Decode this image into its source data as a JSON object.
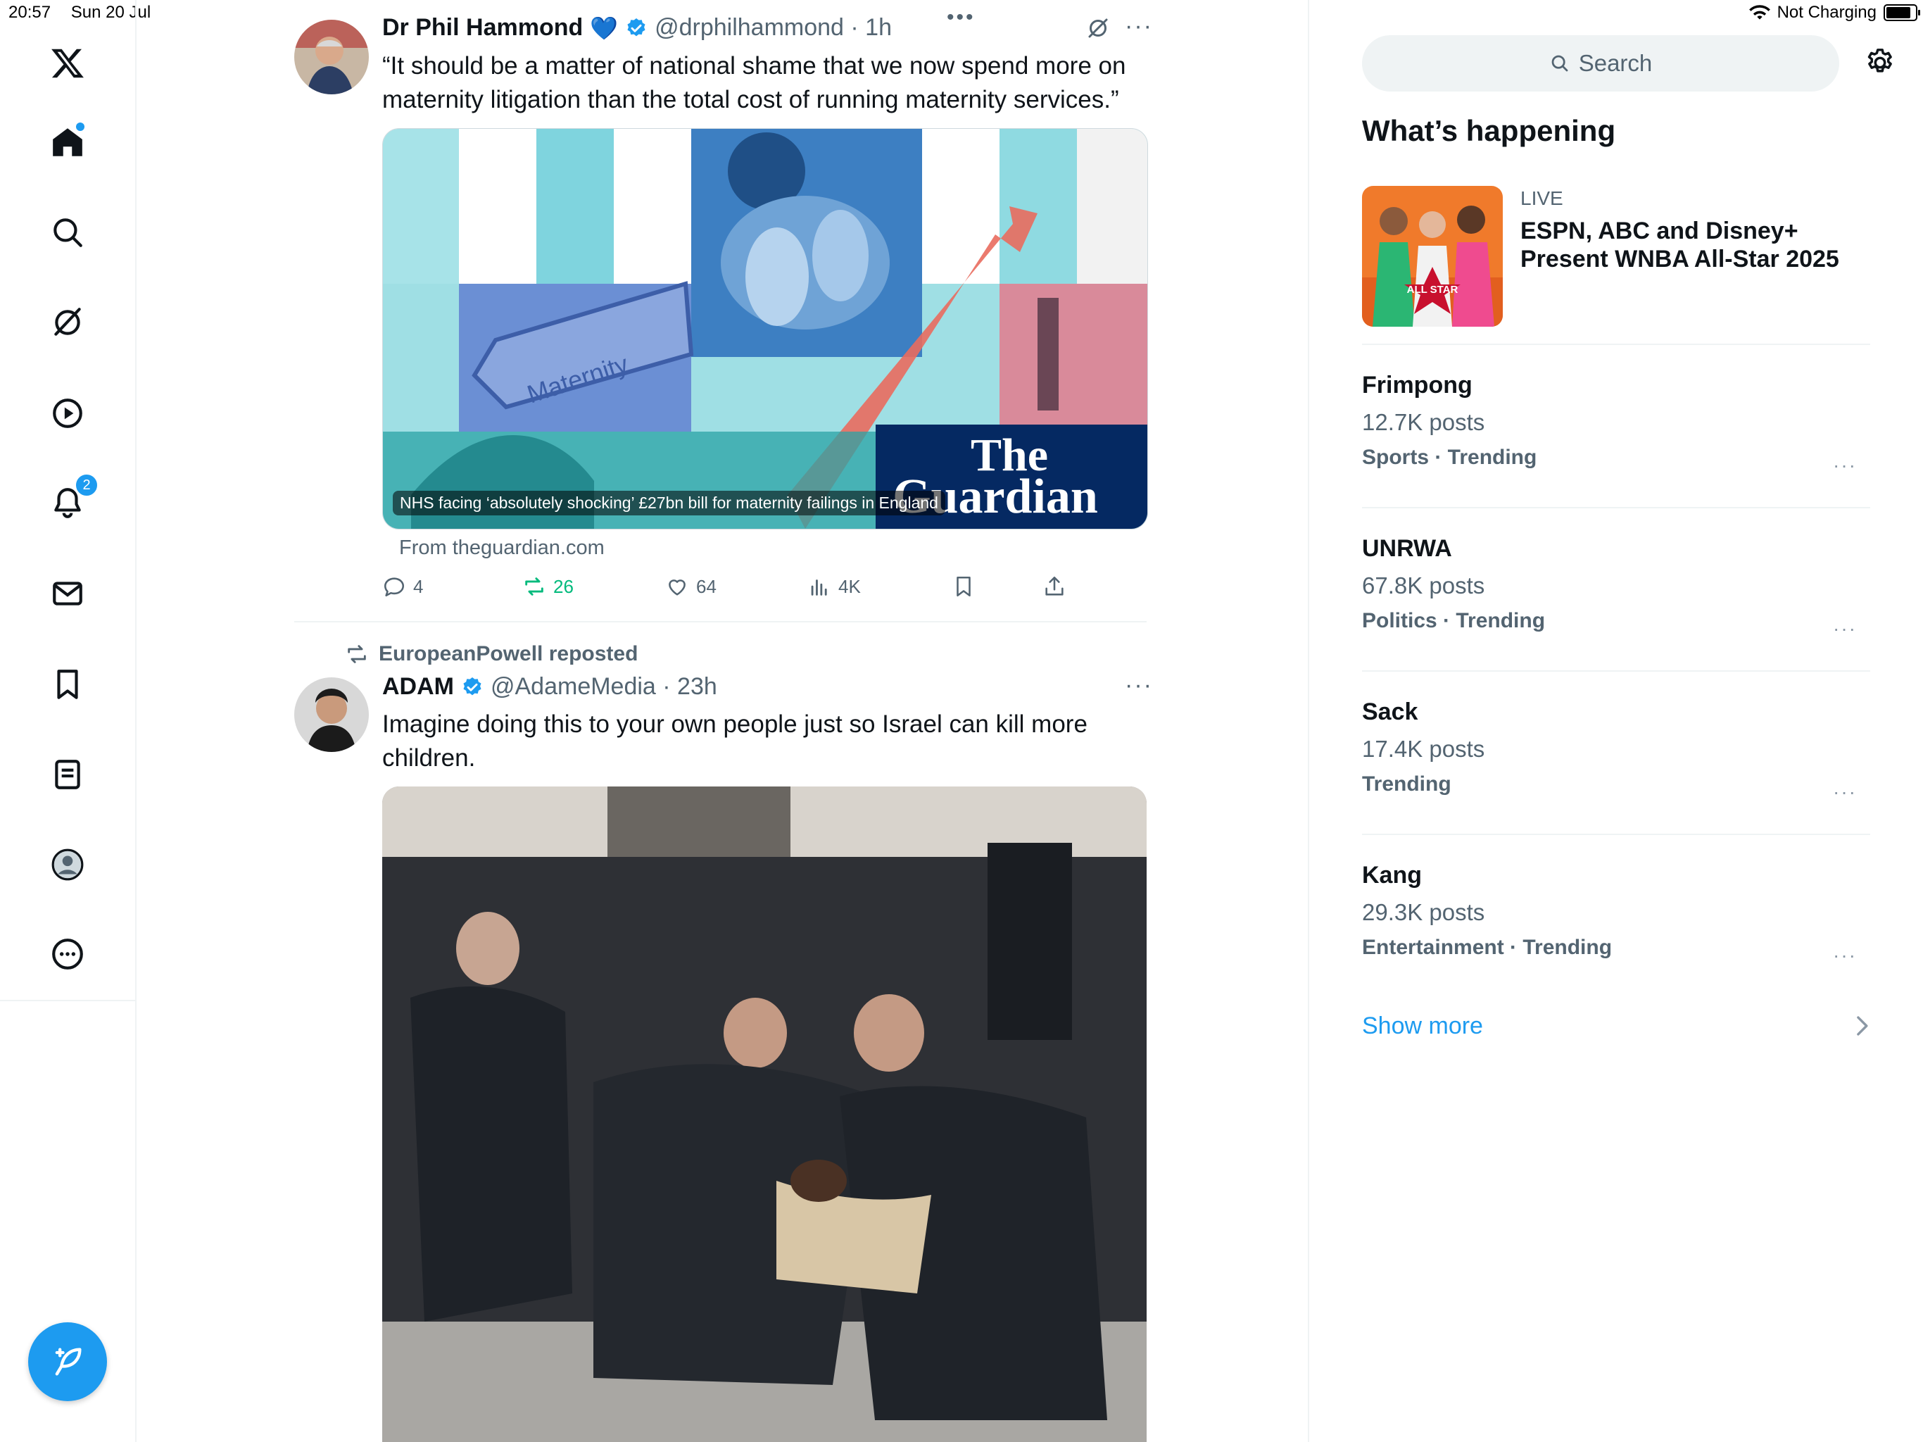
{
  "status_bar": {
    "time": "20:57",
    "date": "Sun 20 Jul",
    "battery_text": "Not Charging"
  },
  "nav": {
    "notifications_badge": "2",
    "items": [
      "x-logo-icon",
      "home-icon",
      "search-icon",
      "grok-icon",
      "video-icon",
      "bell-icon",
      "mail-icon",
      "bookmark-icon",
      "lists-icon",
      "profile-icon",
      "more-icon"
    ]
  },
  "feed": {
    "tweet1": {
      "name": "Dr Phil Hammond",
      "heart_emoji": "💙",
      "handle_time": "@drphilhammond · 1h",
      "text": "“It should be a matter of national shame that we now spend more on maternity litigation than the total cost of running maternity services.”",
      "card": {
        "logo_line1": "The",
        "logo_line2": "Guardian",
        "sign_text": "Maternity",
        "caption": "NHS facing ‘absolutely shocking’ £27bn bill for maternity failings in England",
        "source": "From theguardian.com"
      },
      "actions": {
        "replies": "4",
        "reposts": "26",
        "likes": "64",
        "views": "4K"
      }
    },
    "tweet2": {
      "reposted_by": "EuropeanPowell reposted",
      "name": "ADAM",
      "handle_time": "@AdameMedia · 23h",
      "text": "Imagine doing this to your own people just so Israel can kill more children."
    }
  },
  "sidebar": {
    "search_placeholder": "Search",
    "heading": "What’s happening",
    "live": {
      "label": "LIVE",
      "title_line1": "ESPN, ABC and Disney+",
      "title_line2": "Present WNBA All-Star 2025",
      "image_text": "ALL STAR"
    },
    "trends": [
      {
        "title": "Frimpong",
        "posts": "12.7K posts",
        "category": "Sports · Trending"
      },
      {
        "title": "UNRWA",
        "posts": "67.8K posts",
        "category": "Politics · Trending"
      },
      {
        "title": "Sack",
        "posts": "17.4K posts",
        "category": "Trending"
      },
      {
        "title": "Kang",
        "posts": "29.3K posts",
        "category": "Entertainment · Trending"
      }
    ],
    "show_more": "Show more"
  },
  "colors": {
    "accent": "#1d9bf0",
    "repost_green": "#00ba7c",
    "text_secondary": "#536471",
    "guardian_navy": "#052962"
  }
}
